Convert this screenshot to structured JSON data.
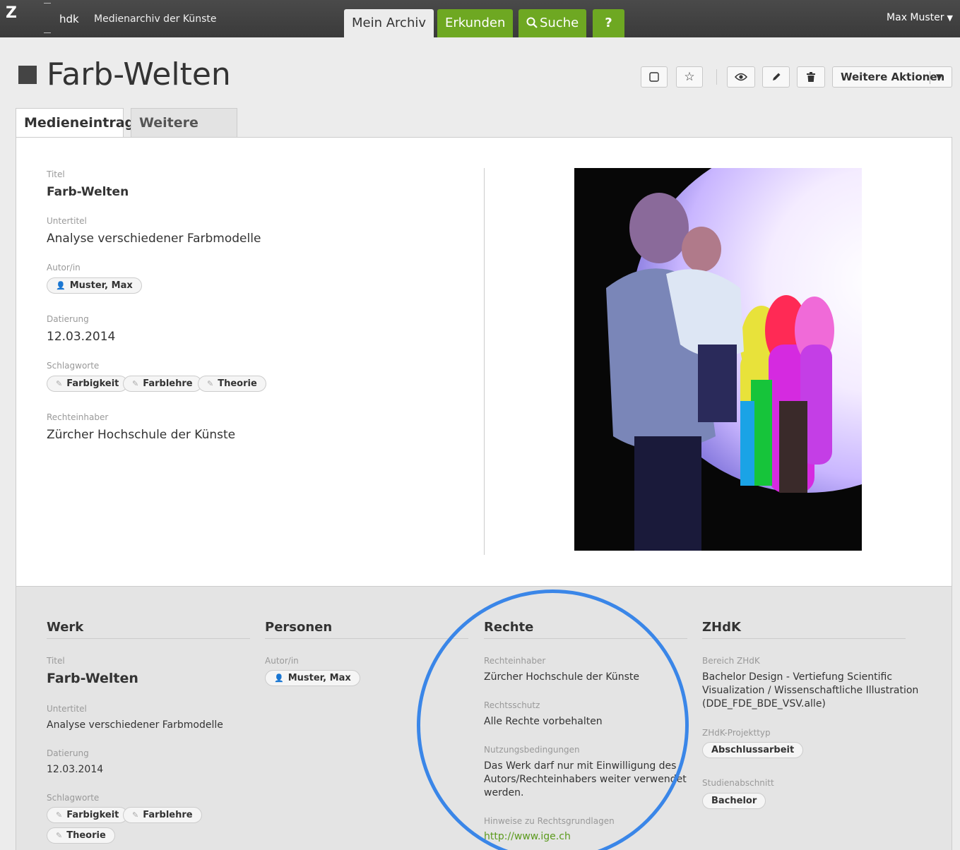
{
  "topbar": {
    "logo_letter": "Z",
    "brand_hdk": "hdk",
    "brand_title": "Medienarchiv der Künste",
    "nav": {
      "mein_archiv": "Mein Archiv",
      "erkunden": "Erkunden",
      "suche": "Suche",
      "help": "?"
    },
    "user": "Max Muster"
  },
  "header": {
    "title": "Farb-Welten",
    "more_actions": "Weitere Aktionen"
  },
  "tabs": {
    "medieneintrag": "Medieneintrag",
    "weitere_daten": "Weitere Daten"
  },
  "entry": {
    "titel_label": "Titel",
    "titel": "Farb-Welten",
    "untertitel_label": "Untertitel",
    "untertitel": "Analyse verschiedener Farbmodelle",
    "autor_label": "Autor/in",
    "autor": "Muster, Max",
    "datierung_label": "Datierung",
    "datierung": "12.03.2014",
    "schlagworte_label": "Schlagworte",
    "schlagworte": [
      "Farbigkeit",
      "Farblehre",
      "Theorie"
    ],
    "rechteinhaber_label": "Rechteinhaber",
    "rechteinhaber": "Zürcher Hochschule der Künste"
  },
  "sections": {
    "werk": {
      "heading": "Werk",
      "titel_label": "Titel",
      "titel": "Farb-Welten",
      "untertitel_label": "Untertitel",
      "untertitel": "Analyse verschiedener Farbmodelle",
      "datierung_label": "Datierung",
      "datierung": "12.03.2014",
      "schlagworte_label": "Schlagworte",
      "schlagworte": [
        "Farbigkeit",
        "Farblehre",
        "Theorie"
      ]
    },
    "personen": {
      "heading": "Personen",
      "autor_label": "Autor/in",
      "autor": "Muster, Max"
    },
    "rechte": {
      "heading": "Rechte",
      "rechteinhaber_label": "Rechteinhaber",
      "rechteinhaber": "Zürcher Hochschule der Künste",
      "rechtsschutz_label": "Rechtsschutz",
      "rechtsschutz": "Alle Rechte vorbehalten",
      "nutzung_label": "Nutzungsbedingungen",
      "nutzung_line1": "Das Werk darf nur mit Einwilligung des",
      "nutzung_line2": "Autors/Rechteinhabers weiter verwendet",
      "nutzung_line3": "werden.",
      "hinweise_label": "Hinweise zu Rechtsgrundlagen",
      "hinweise_link": "http://www.ige.ch"
    },
    "zhdk": {
      "heading": "ZHdK",
      "bereich_label": "Bereich ZHdK",
      "bereich_line1": "Bachelor Design - Vertiefung Scientific",
      "bereich_line2": "Visualization / Wissenschaftliche Illustration",
      "bereich_line3": "(DDE_FDE_BDE_VSV.alle)",
      "projekttyp_label": "ZHdK-Projekttyp",
      "projekttyp": "Abschlussarbeit",
      "studienabschnitt_label": "Studienabschnitt",
      "studienabschnitt": "Bachelor"
    }
  },
  "colors": {
    "green": "#6ea822",
    "annotation_circle": "#3a86e8",
    "topbar": "#3e3e3e"
  }
}
